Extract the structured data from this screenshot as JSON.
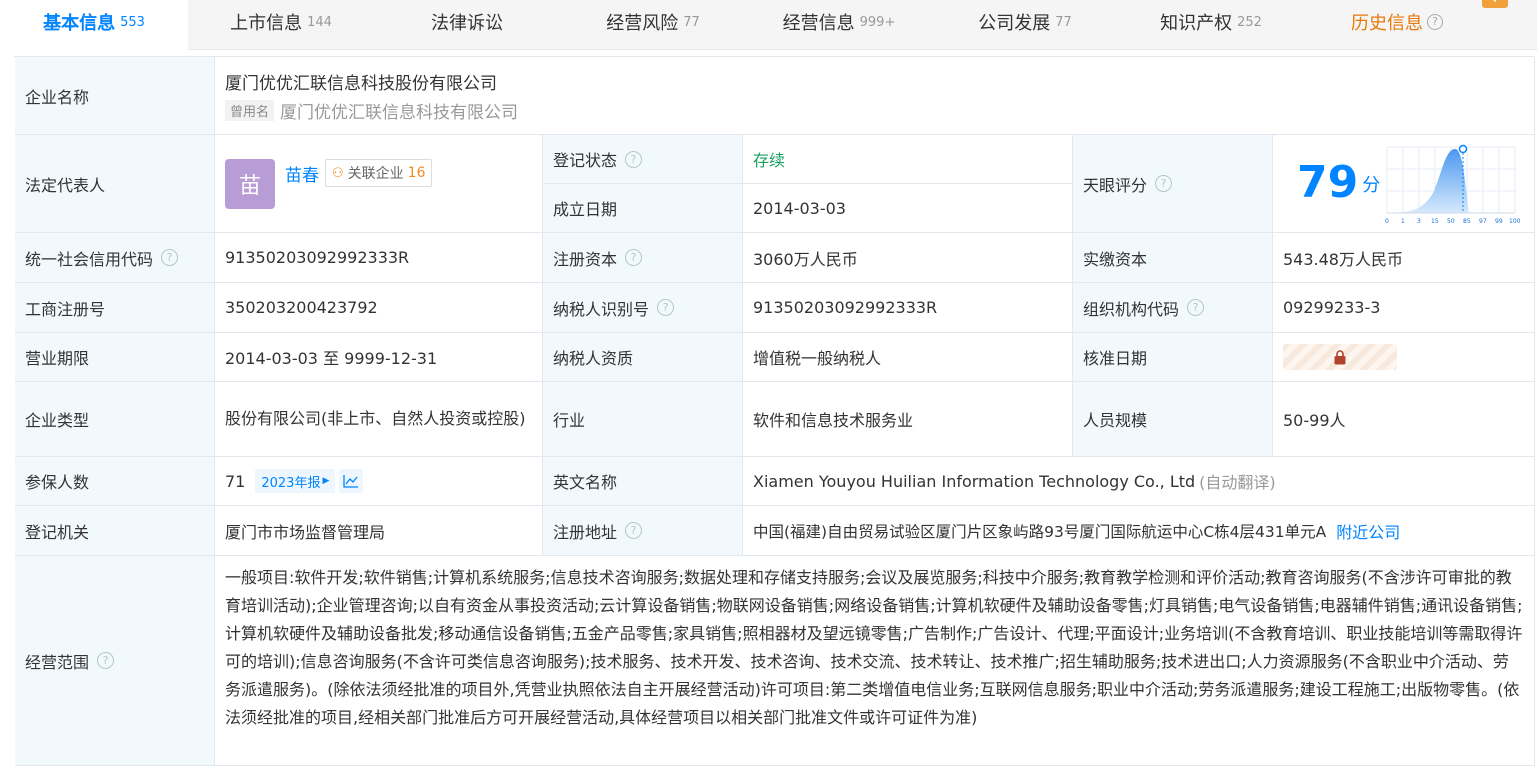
{
  "tabs": [
    {
      "label": "基本信息",
      "count": "553"
    },
    {
      "label": "上市信息",
      "count": "144"
    },
    {
      "label": "法律诉讼",
      "count": ""
    },
    {
      "label": "经营风险",
      "count": "77"
    },
    {
      "label": "经营信息",
      "count": "999+"
    },
    {
      "label": "公司发展",
      "count": "77"
    },
    {
      "label": "知识产权",
      "count": "252"
    },
    {
      "label": "历史信息",
      "count": ""
    }
  ],
  "colors": {
    "accent": "#0084ff",
    "label_bg": "#f2f9fc",
    "status_green": "#19a15f",
    "history_orange": "#e8790c"
  },
  "company": {
    "name_label": "企业名称",
    "name": "厦门优优汇联信息科技股份有限公司",
    "used_name_tag": "曾用名",
    "used_name": "厦门优优汇联信息科技有限公司"
  },
  "legal": {
    "label": "法定代表人",
    "avatar_char": "苗",
    "person": "苗春",
    "related_label": "关联企业",
    "related_count": "16"
  },
  "reg_status": {
    "label": "登记状态",
    "value": "存续"
  },
  "established": {
    "label": "成立日期",
    "value": "2014-03-03"
  },
  "tianyan": {
    "label": "天眼评分",
    "score": "79",
    "unit": "分",
    "chart_ticks": [
      "0",
      "1",
      "3",
      "15",
      "50",
      "85",
      "97",
      "99",
      "100"
    ]
  },
  "credit_code": {
    "label": "统一社会信用代码",
    "value": "91350203092992333R"
  },
  "reg_capital": {
    "label": "注册资本",
    "value": "3060万人民币"
  },
  "paid_capital": {
    "label": "实缴资本",
    "value": "543.48万人民币"
  },
  "biz_reg_no": {
    "label": "工商注册号",
    "value": "350203200423792"
  },
  "taxpayer_id": {
    "label": "纳税人识别号",
    "value": "91350203092992333R"
  },
  "org_code": {
    "label": "组织机构代码",
    "value": "09299233-3"
  },
  "biz_term": {
    "label": "营业期限",
    "value": "2014-03-03 至 9999-12-31"
  },
  "taxpayer_qual": {
    "label": "纳税人资质",
    "value": "增值税一般纳税人"
  },
  "approve_date": {
    "label": "核准日期"
  },
  "company_type": {
    "label": "企业类型",
    "value": "股份有限公司(非上市、自然人投资或控股)"
  },
  "industry": {
    "label": "行业",
    "value": "软件和信息技术服务业"
  },
  "staff_size": {
    "label": "人员规模",
    "value": "50-99人"
  },
  "insured": {
    "label": "参保人数",
    "value": "71",
    "report": "2023年报"
  },
  "english_name": {
    "label": "英文名称",
    "value": "Xiamen Youyou Huilian Information Technology Co., Ltd",
    "note": "(自动翻译)"
  },
  "reg_authority": {
    "label": "登记机关",
    "value": "厦门市市场监督管理局"
  },
  "reg_address": {
    "label": "注册地址",
    "value": "中国(福建)自由贸易试验区厦门片区象屿路93号厦门国际航运中心C栋4层431单元A",
    "nearby": "附近公司"
  },
  "scope": {
    "label": "经营范围",
    "value": "一般项目:软件开发;软件销售;计算机系统服务;信息技术咨询服务;数据处理和存储支持服务;会议及展览服务;科技中介服务;教育教学检测和评价活动;教育咨询服务(不含涉许可审批的教育培训活动);企业管理咨询;以自有资金从事投资活动;云计算设备销售;物联网设备销售;网络设备销售;计算机软硬件及辅助设备零售;灯具销售;电气设备销售;电器辅件销售;通讯设备销售;计算机软硬件及辅助设备批发;移动通信设备销售;五金产品零售;家具销售;照相器材及望远镜零售;广告制作;广告设计、代理;平面设计;业务培训(不含教育培训、职业技能培训等需取得许可的培训);信息咨询服务(不含许可类信息咨询服务);技术服务、技术开发、技术咨询、技术交流、技术转让、技术推广;招生辅助服务;技术进出口;人力资源服务(不含职业中介活动、劳务派遣服务)。(除依法须经批准的项目外,凭营业执照依法自主开展经营活动)许可项目:第二类增值电信业务;互联网信息服务;职业中介活动;劳务派遣服务;建设工程施工;出版物零售。(依法须经批准的项目,经相关部门批准后方可开展经营活动,具体经营项目以相关部门批准文件或许可证件为准)"
  }
}
